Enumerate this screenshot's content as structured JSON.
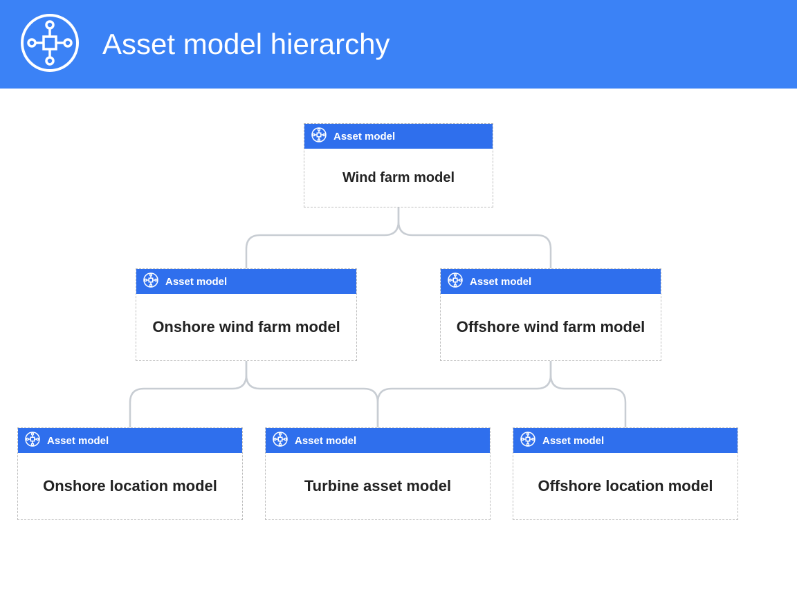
{
  "header": {
    "title": "Asset model hierarchy"
  },
  "node_label": "Asset model",
  "nodes": {
    "root": {
      "name": "Wind farm model"
    },
    "onshore": {
      "name": "Onshore wind farm model"
    },
    "offshore": {
      "name": "Offshore wind farm model"
    },
    "onloc": {
      "name": "Onshore location model"
    },
    "turbine": {
      "name": "Turbine asset model"
    },
    "offloc": {
      "name": "Offshore location model"
    }
  },
  "hierarchy": {
    "root": "Wind farm model",
    "children": [
      {
        "name": "Onshore wind farm model",
        "children": [
          {
            "name": "Onshore location model"
          },
          {
            "name": "Turbine asset model"
          }
        ]
      },
      {
        "name": "Offshore wind farm model",
        "children": [
          {
            "name": "Turbine asset model"
          },
          {
            "name": "Offshore location model"
          }
        ]
      }
    ]
  },
  "colors": {
    "header_bg": "#3B82F6",
    "node_header_bg": "#2F6FED",
    "connector": "#c8cdd3"
  }
}
